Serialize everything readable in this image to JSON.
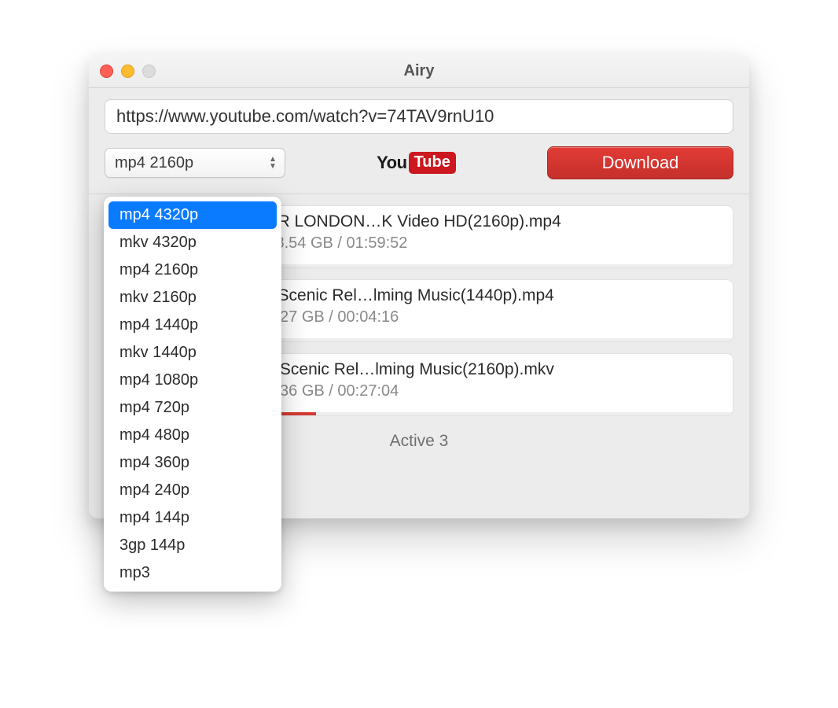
{
  "window": {
    "title": "Airy"
  },
  "toolbar": {
    "url_value": "https://www.youtube.com/watch?v=74TAV9rnU10",
    "format_selected": "mp4 2160p",
    "download_label": "Download",
    "logo_you": "You",
    "logo_tube": "Tube"
  },
  "format_dropdown": {
    "options": [
      "mp4 4320p",
      "mkv 4320p",
      "mp4 2160p",
      "mkv 2160p",
      "mp4 1440p",
      "mkv 1440p",
      "mp4 1080p",
      "mp4 720p",
      "mp4 480p",
      "mp4 360p",
      "mp4 240p",
      "mp4 144p",
      "3gp 144p",
      "mp3"
    ],
    "highlighted_index": 0
  },
  "downloads": [
    {
      "title": "ING OVER LONDON…K Video HD(2160p).mp4",
      "subtitle": "0 GB of 18.54 GB / 01:59:52",
      "progress_pct": 0
    },
    {
      "title": "way 4K - Scenic Rel…lming Music(1440p).mp4",
      "subtitle": "2 GB of 3.27 GB / 00:04:16",
      "progress_pct": 10
    },
    {
      "title": "aine 4K - Scenic Rel…lming Music(2160p).mkv",
      "subtitle": "4 GB of 7.36 GB / 00:27:04",
      "progress_pct": 22
    }
  ],
  "footer": {
    "status": "Active 3"
  }
}
